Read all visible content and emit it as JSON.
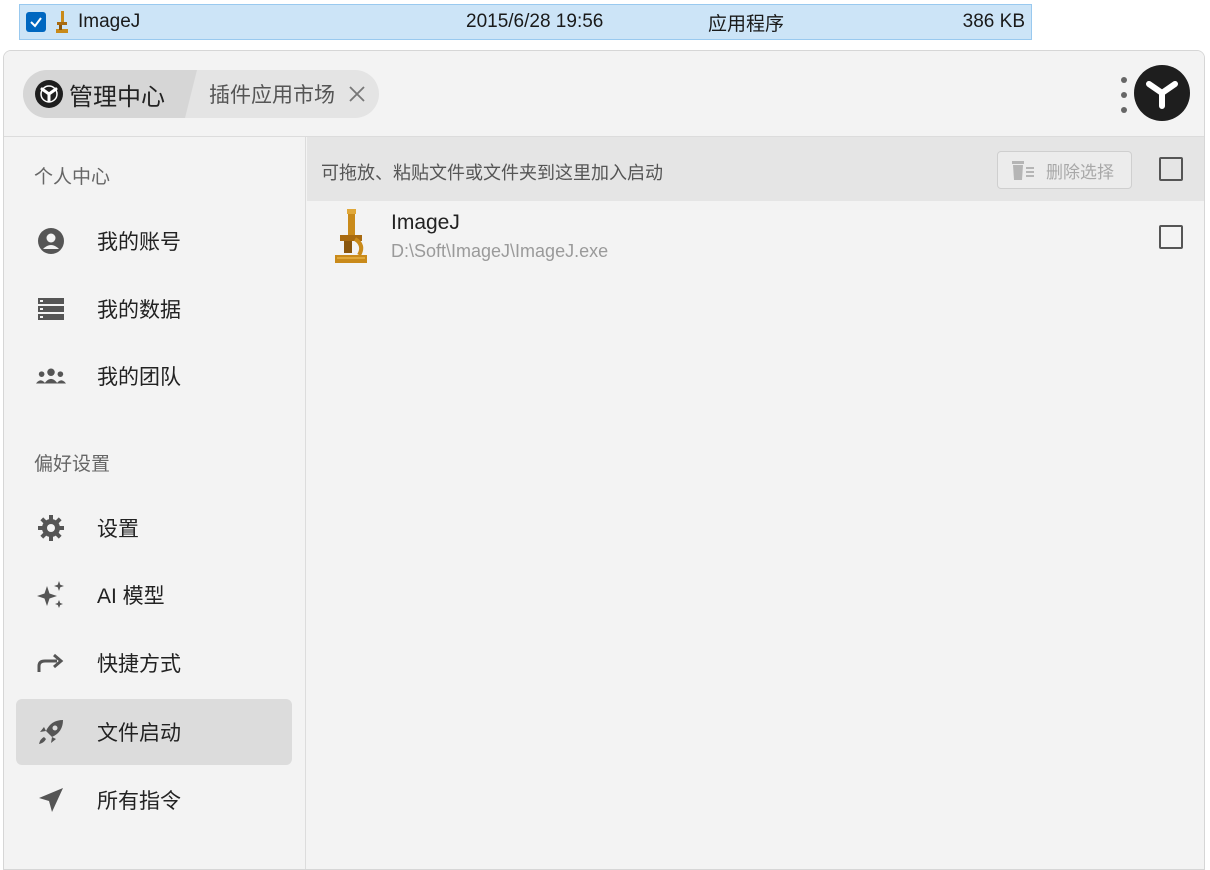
{
  "explorer_row": {
    "name": "ImageJ",
    "date": "2015/6/28 19:56",
    "type": "应用程序",
    "size": "386 KB"
  },
  "header": {
    "tab_active": "管理中心",
    "tab_2": "插件应用市场"
  },
  "sidebar": {
    "section_personal": "个人中心",
    "section_prefs": "偏好设置",
    "items": [
      {
        "label": "我的账号",
        "icon": "account-circle-icon"
      },
      {
        "label": "我的数据",
        "icon": "data-list-icon"
      },
      {
        "label": "我的团队",
        "icon": "team-icon"
      },
      {
        "label": "设置",
        "icon": "gear-icon"
      },
      {
        "label": "AI 模型",
        "icon": "sparkle-icon"
      },
      {
        "label": "快捷方式",
        "icon": "share-arrow-icon"
      },
      {
        "label": "文件启动",
        "icon": "rocket-icon"
      },
      {
        "label": "所有指令",
        "icon": "send-icon"
      }
    ]
  },
  "main": {
    "drop_hint": "可拖放、粘贴文件或文件夹到这里加入启动",
    "delete_button": "删除选择",
    "apps": [
      {
        "name": "ImageJ",
        "path": "D:\\Soft\\ImageJ\\ImageJ.exe",
        "icon": "microscope-icon"
      }
    ]
  },
  "colors": {
    "accent": "#0067c0",
    "active_nav": "#dcdcdc"
  }
}
